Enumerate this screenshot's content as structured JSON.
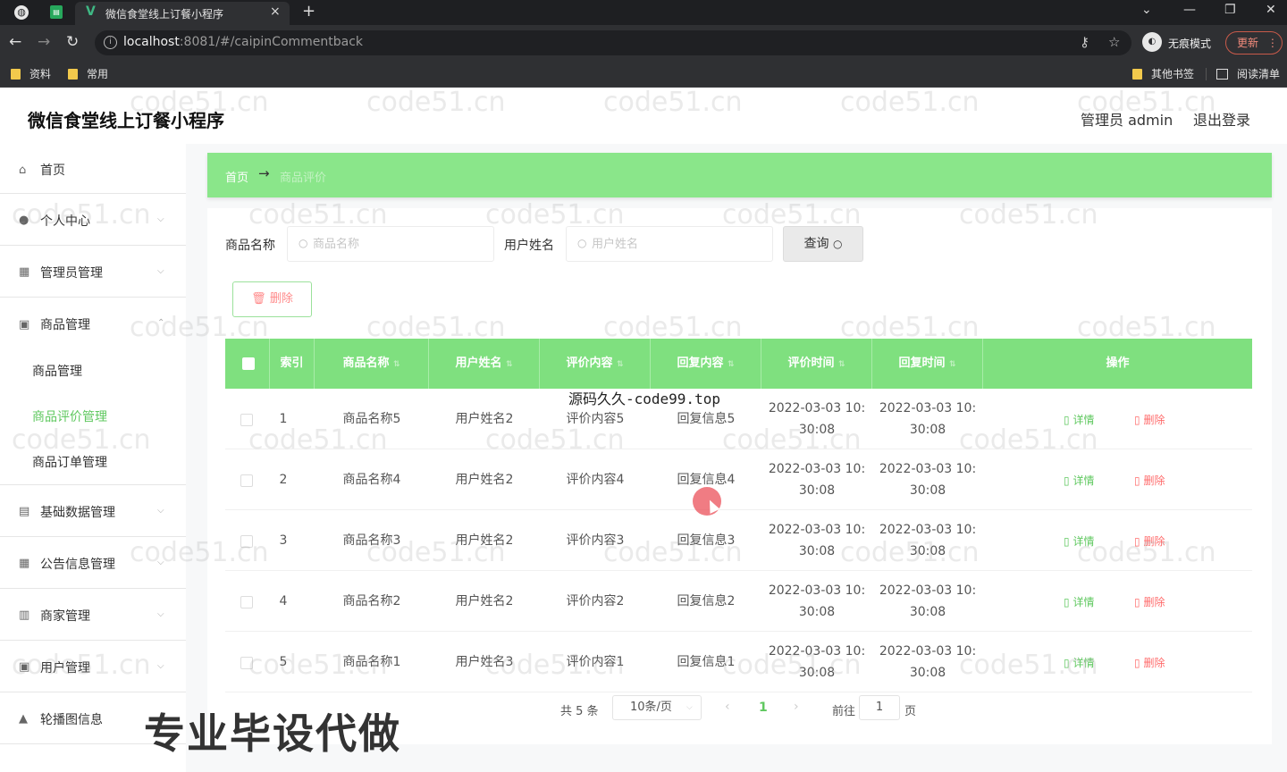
{
  "browser": {
    "tab_title": "微信食堂线上订餐小程序",
    "tab_close": "×",
    "new_tab": "+",
    "url_host": "localhost",
    "url_rest": ":8081/#/caipinCommentback",
    "incognito_label": "无痕模式",
    "update_label": "更新",
    "bookmarks": [
      "资料",
      "常用"
    ],
    "other_bookmarks": "其他书签",
    "reading_list": "阅读清单"
  },
  "app": {
    "title": "微信食堂线上订餐小程序",
    "admin_label": "管理员 admin",
    "logout": "退出登录"
  },
  "sidebar": {
    "items": [
      {
        "label": "首页",
        "icon": "home-icon"
      },
      {
        "label": "个人中心",
        "icon": "user-icon"
      },
      {
        "label": "管理员管理",
        "icon": "admin-icon"
      },
      {
        "label": "商品管理",
        "icon": "goods-icon"
      },
      {
        "label": "基础数据管理",
        "icon": "data-icon"
      },
      {
        "label": "公告信息管理",
        "icon": "notice-icon"
      },
      {
        "label": "商家管理",
        "icon": "shop-icon"
      },
      {
        "label": "用户管理",
        "icon": "users-icon"
      },
      {
        "label": "轮播图信息",
        "icon": "carousel-icon"
      }
    ],
    "sub_items": [
      "商品管理",
      "商品评价管理",
      "商品订单管理"
    ]
  },
  "breadcrumb": {
    "home": "首页",
    "arrow": "→",
    "current": "商品评价"
  },
  "search": {
    "goods_label": "商品名称",
    "goods_placeholder": "商品名称",
    "user_label": "用户姓名",
    "user_placeholder": "用户姓名",
    "query_label": "查询"
  },
  "toolbar": {
    "delete_label": "删除"
  },
  "table": {
    "columns": [
      "索引",
      "商品名称",
      "用户姓名",
      "评价内容",
      "回复内容",
      "评价时间",
      "回复时间",
      "操作"
    ],
    "rows": [
      {
        "index": "1",
        "goods": "商品名称5",
        "user": "用户姓名2",
        "content": "评价内容5",
        "reply": "回复信息5",
        "comment_time_a": "2022-03-03 10:",
        "comment_time_b": "30:08",
        "reply_time_a": "2022-03-03 10:",
        "reply_time_b": "30:08"
      },
      {
        "index": "2",
        "goods": "商品名称4",
        "user": "用户姓名2",
        "content": "评价内容4",
        "reply": "回复信息4",
        "comment_time_a": "2022-03-03 10:",
        "comment_time_b": "30:08",
        "reply_time_a": "2022-03-03 10:",
        "reply_time_b": "30:08"
      },
      {
        "index": "3",
        "goods": "商品名称3",
        "user": "用户姓名2",
        "content": "评价内容3",
        "reply": "回复信息3",
        "comment_time_a": "2022-03-03 10:",
        "comment_time_b": "30:08",
        "reply_time_a": "2022-03-03 10:",
        "reply_time_b": "30:08"
      },
      {
        "index": "4",
        "goods": "商品名称2",
        "user": "用户姓名2",
        "content": "评价内容2",
        "reply": "回复信息2",
        "comment_time_a": "2022-03-03 10:",
        "comment_time_b": "30:08",
        "reply_time_a": "2022-03-03 10:",
        "reply_time_b": "30:08"
      },
      {
        "index": "5",
        "goods": "商品名称1",
        "user": "用户姓名3",
        "content": "评价内容1",
        "reply": "回复信息1",
        "comment_time_a": "2022-03-03 10:",
        "comment_time_b": "30:08",
        "reply_time_a": "2022-03-03 10:",
        "reply_time_b": "30:08"
      }
    ],
    "detail_label": "详情",
    "delete_label": "删除"
  },
  "pager": {
    "total": "共 5 条",
    "page_size": "10条/页",
    "current": "1",
    "goto": "前往",
    "goto_value": "1",
    "page_suffix": "页"
  },
  "overlays": {
    "watermark": "code51.cn",
    "mid_text": "源码久久-code99.top",
    "big_text": "专业毕设代做"
  },
  "colors": {
    "accent": "#7fe07f",
    "active_menu": "#5fc85f",
    "danger": "#ff6b6b"
  }
}
